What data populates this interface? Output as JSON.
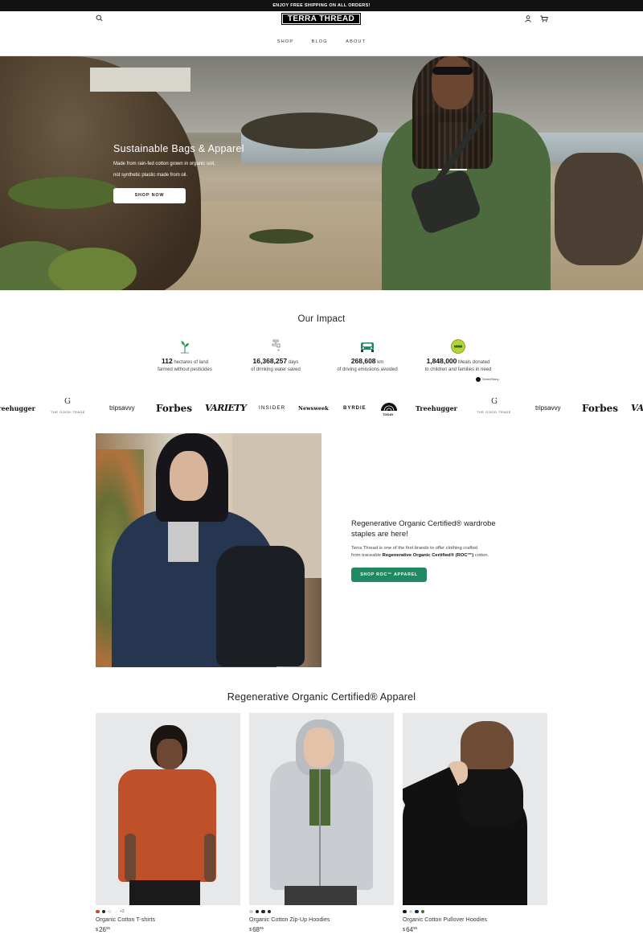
{
  "announcement": "ENJOY FREE SHIPPING ON ALL ORDERS!",
  "header": {
    "logo": "TERRA THREAD",
    "nav": [
      "SHOP",
      "BLOG",
      "ABOUT"
    ],
    "icons": [
      "search-icon",
      "account-icon",
      "cart-icon"
    ]
  },
  "hero": {
    "title": "Sustainable Bags & Apparel",
    "subtitle_line1": "Made from rain-fed cotton grown in organic soil,",
    "subtitle_line2": "not synthetic plastic made from oil.",
    "button": "SHOP NOW"
  },
  "impact": {
    "title": "Our Impact",
    "items": [
      {
        "icon": "sprout-icon",
        "number": "112",
        "unit": " hectares of land",
        "line2": "farmed without pesticides"
      },
      {
        "icon": "faucet-icon",
        "number": "16,368,257",
        "unit": " days",
        "line2": "of drinking water saved"
      },
      {
        "icon": "car-icon",
        "number": "268,608",
        "unit": " km",
        "line2": "of driving emissions avoided"
      },
      {
        "icon": "meal-badge-icon",
        "number": "1,848,000",
        "unit": " Meals donated",
        "line2": "to children and families in need"
      }
    ],
    "partner": "GreenStory",
    "colors": {
      "accent": "#1f8a61",
      "badge": "#b7d334"
    }
  },
  "press": [
    "Treehugger",
    "THE GOOD TRADE",
    "tripsavvy",
    "Forbes",
    "VARIETY",
    "INSIDER",
    "Newsweek",
    "BYRDIE",
    "TODAY",
    "Treehugger",
    "THE GOOD TRADE",
    "tripsavvy",
    "Forbes",
    "VARIETY"
  ],
  "feature": {
    "title_line1": "Regenerative Organic Certified® wardrobe",
    "title_line2": "staples are here!",
    "body_line1": "Terra Thread is one of the first brands to offer clothing crafted",
    "body_line2_pre": "from traceable ",
    "body_line2_bold": "Regenerative Organic Certified® (ROC™)",
    "body_line2_post": " cotton.",
    "button": "SHOP ROC™ APPAREL"
  },
  "products": {
    "title": "Regenerative Organic Certified® Apparel",
    "items": [
      {
        "name": "Organic Cotton T-shirts",
        "currency": "$",
        "price": "26",
        "cents": "95",
        "swatches": [
          "#c0502a",
          "#1e2433",
          "#e6e6e6",
          "#f4f4f4"
        ],
        "more": "+2"
      },
      {
        "name": "Organic Cotton Zip-Up Hoodies",
        "currency": "$",
        "price": "68",
        "cents": "95",
        "swatches": [
          "#cfd2d6",
          "#1b1b1b",
          "#1e2433",
          "#2a2a2a"
        ],
        "more": ""
      },
      {
        "name": "Organic Cotton Pullover Hoodies",
        "currency": "$",
        "price": "64",
        "cents": "95",
        "swatches": [
          "#111111",
          "#cfd2d6",
          "#1e2433",
          "#4c6a3e"
        ],
        "more": ""
      }
    ]
  }
}
